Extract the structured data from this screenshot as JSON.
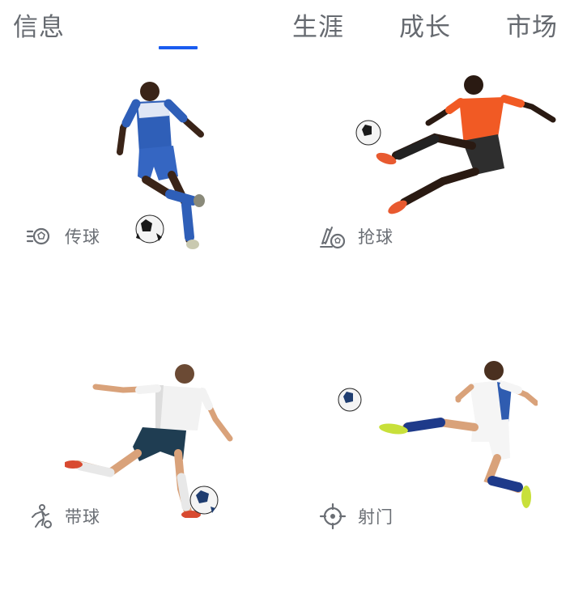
{
  "tabs": [
    {
      "label": "信息"
    },
    {
      "label": "生涯"
    },
    {
      "label": "成长"
    },
    {
      "label": "市场"
    }
  ],
  "active_tab": "信息",
  "colors": {
    "accent": "#1a5cf0",
    "tab_text": "#666a70",
    "label_text": "#6a6e74"
  },
  "skills": [
    {
      "label": "传球",
      "icon": "pass-ball-icon"
    },
    {
      "label": "抢球",
      "icon": "tackle-icon"
    },
    {
      "label": "带球",
      "icon": "dribble-icon"
    },
    {
      "label": "射门",
      "icon": "target-icon"
    }
  ]
}
